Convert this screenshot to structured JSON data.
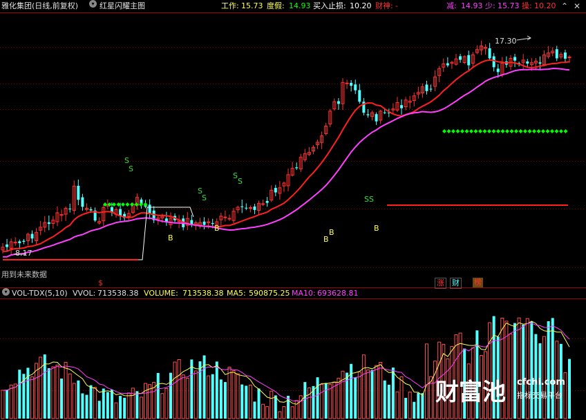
{
  "header": {
    "stock_title": "雅化集团(日线,前复权)",
    "indicator_name": "红星闪耀主图",
    "work_label": "工作: ",
    "work_value": "15.73",
    "dujia_label": "度假: ",
    "dujia_value": "14.93",
    "stoploss_label": "买入止损: ",
    "stoploss_value": "10.20",
    "caishen_label": "财神: ",
    "caishen_value": "-",
    "jian_label": "减: ",
    "jian_value": "14.93",
    "shao_label": "少: ",
    "shao_value": "15.73",
    "cao_label": "操: ",
    "cao_value": "10.20"
  },
  "main_panel": {
    "max_price_label": "17.30",
    "min_price_label": "8.17",
    "future_data_note": "用到未来数据",
    "signal_s": "S",
    "signal_b": "B",
    "signal_ss": "SS",
    "dollar_marker": "$",
    "tags": [
      "涨",
      "财",
      "榜"
    ]
  },
  "volume_panel": {
    "indicator": "VOL-TDX(5,10)",
    "vvol_label": "VVOL: ",
    "vvol_value": "713538.38",
    "volume_label": "VOLUME: ",
    "volume_value": "713538.38",
    "ma5_label": "MA5: ",
    "ma5_value": "590875.25",
    "ma10_label": "MA10: ",
    "ma10_value": "693628.81"
  },
  "watermark": {
    "brand": "财富池",
    "site": "cfchi.com",
    "slogan": "指标交易平台"
  },
  "colors": {
    "up": "#ff3232",
    "down": "#54ffff",
    "ma_red": "#ff2020",
    "ma_magenta": "#ff40ff",
    "green_diamond": "#00ff00",
    "yellow": "#ffff54",
    "grid": "#8b0000"
  }
}
